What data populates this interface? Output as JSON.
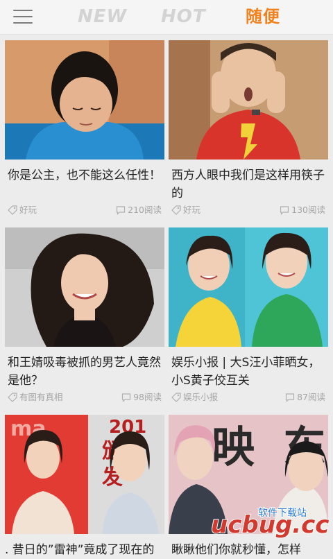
{
  "header": {
    "menu_icon": "hamburger-menu-icon",
    "tabs": [
      {
        "label": "NEW",
        "active": false
      },
      {
        "label": "HOT",
        "active": false
      },
      {
        "label": "随便",
        "active": true
      }
    ],
    "accent_color": "#f0821e",
    "inactive_color": "#d3d3d3"
  },
  "feed": [
    {
      "title": "你是公主，也不能这么任性！",
      "tag": "好玩",
      "reads": "210阅读"
    },
    {
      "title": "西方人眼中我们是这样用筷子的",
      "tag": "好玩",
      "reads": "130阅读"
    },
    {
      "title": "和王婧吸毒被抓的男艺人竟然是他？",
      "tag": "有图有真相",
      "reads": "98阅读"
    },
    {
      "title": "娱乐小报 | 大S汪小菲晒女，小S黄子佼互关",
      "tag": "娱乐小报",
      "reads": "87阅读"
    },
    {
      "title": ". 昔日的”雷神”竟成了现在的",
      "tag": "",
      "reads": ""
    },
    {
      "title": "瞅瞅他们你就秒懂，怎样",
      "tag": "",
      "reads": ""
    }
  ],
  "thumbnail_text": {
    "sign_top": "201",
    "sign_mid": "颁",
    "sign_low": "发",
    "brand_left": "ma",
    "poster_1": "映",
    "poster_2": "东"
  },
  "watermark": {
    "text": "ucbug.cc",
    "subtext": "软件下载站"
  }
}
